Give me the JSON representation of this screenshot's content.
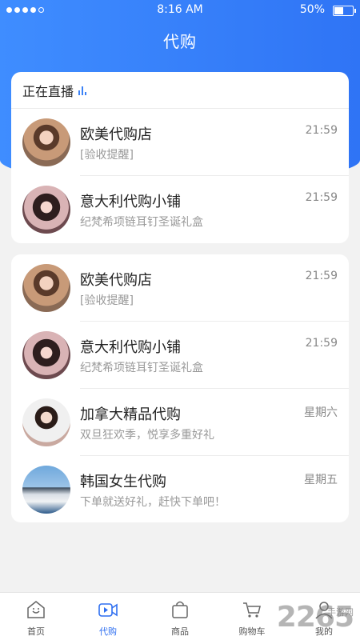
{
  "status_bar": {
    "time": "8:16 AM",
    "battery": "50%",
    "battery_level": 0.5
  },
  "header": {
    "title": "代购"
  },
  "live": {
    "label": "正在直播"
  },
  "live_list": [
    {
      "name": "欧美代购店",
      "time": "21:59",
      "message": "[验收提醒]",
      "avatar": "avatar-sunglasses"
    },
    {
      "name": "意大利代购小铺",
      "time": "21:59",
      "message": "纪梵希项链耳钉圣诞礼盒",
      "avatar": "avatar-long-hair"
    }
  ],
  "shop_list": [
    {
      "name": "欧美代购店",
      "time": "21:59",
      "message": "[验收提醒]",
      "avatar": "avatar-sunglasses"
    },
    {
      "name": "意大利代购小铺",
      "time": "21:59",
      "message": "纪梵希项链耳钉圣诞礼盒",
      "avatar": "avatar-long-hair"
    },
    {
      "name": "加拿大精品代购",
      "time": "星期六",
      "message": "双旦狂欢季，悦享多重好礼",
      "avatar": "avatar-white-top"
    },
    {
      "name": "韩国女生代购",
      "time": "星期五",
      "message": "下单就送好礼，赶快下单吧！",
      "avatar": "avatar-lighthouse"
    }
  ],
  "tabbar": [
    {
      "label": "首页",
      "icon": "home-icon",
      "active": false
    },
    {
      "label": "代购",
      "icon": "video-icon",
      "active": true
    },
    {
      "label": "商品",
      "icon": "bag-icon",
      "active": false
    },
    {
      "label": "购物车",
      "icon": "cart-icon",
      "active": false
    },
    {
      "label": "我的",
      "icon": "user-icon",
      "active": false
    }
  ],
  "watermark": {
    "text": "2265",
    "suffix": "手游网",
    "com": ".com"
  },
  "colors": {
    "accent": "#2f6ff0",
    "header": "#3a84ff"
  }
}
